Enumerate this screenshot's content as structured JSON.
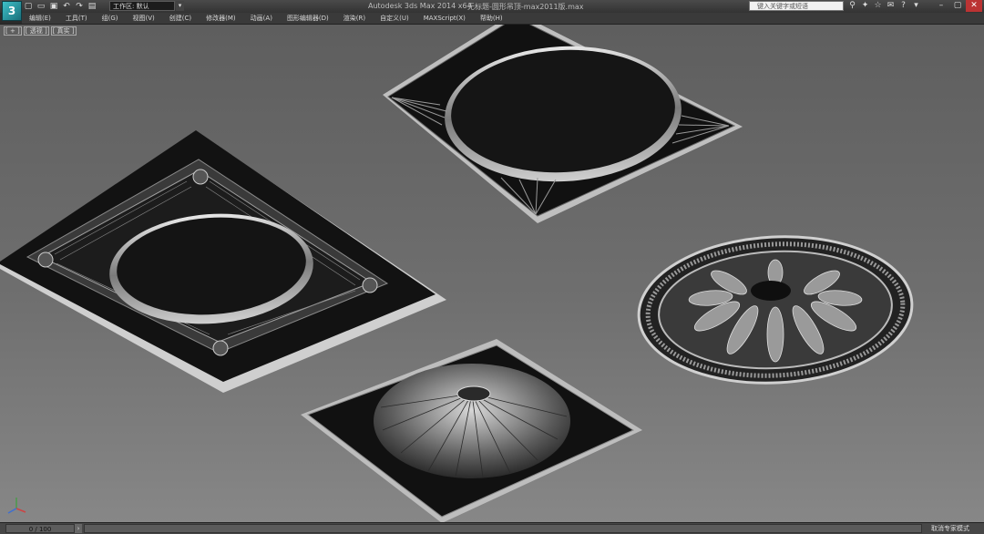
{
  "titlebar": {
    "logo_text": "3",
    "workspace_label": "工作区: 默认",
    "app_title": "Autodesk 3ds Max  2014 x64",
    "file_title": "无标题-圆形吊顶-max2011版.max",
    "search_placeholder": "键入关键字或短语"
  },
  "menu": {
    "items": [
      {
        "label": "编辑(E)"
      },
      {
        "label": "工具(T)"
      },
      {
        "label": "组(G)"
      },
      {
        "label": "视图(V)"
      },
      {
        "label": "创建(C)"
      },
      {
        "label": "修改器(M)"
      },
      {
        "label": "动画(A)"
      },
      {
        "label": "图形编辑器(D)"
      },
      {
        "label": "渲染(R)"
      },
      {
        "label": "自定义(U)"
      },
      {
        "label": "MAXScript(X)"
      },
      {
        "label": "帮助(H)"
      }
    ]
  },
  "viewport": {
    "label_plus": "[ + ]",
    "label_view": "[ 透视 ]",
    "label_shading": "[ 真实 ]"
  },
  "statusbar": {
    "time_slider": "0 / 100",
    "status": "取消专家模式"
  },
  "colors": {
    "accent": "#3ec1c9",
    "viewport_top": "#5e5e5e",
    "viewport_bottom": "#878787"
  }
}
